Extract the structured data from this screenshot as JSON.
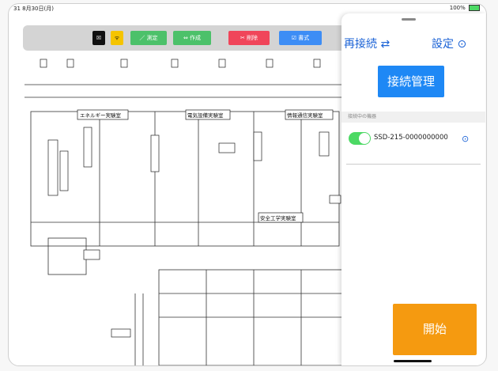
{
  "status": {
    "time": "31  8月30日(月)",
    "battery": "100%"
  },
  "toolbar": {
    "close_label": "☒",
    "wifi_icon": "wifi-icon",
    "measure_label": "／ 測定",
    "create_label": "⇔ 作成",
    "delete_label": "✂ 削除",
    "format_label": "☑ 書式"
  },
  "plan": {
    "rooms": [
      "エネルギー実験室",
      "電気設備実験室",
      "情報通信実験室",
      "安全工学実験室"
    ]
  },
  "panel": {
    "reconnect_label": "再接続",
    "settings_label": "設定",
    "manage_label": "接続管理",
    "section_label": "接続中の機器",
    "device_name": "SSD-215-0000000000",
    "start_label": "開始"
  },
  "colors": {
    "accent": "#1e88f5",
    "start": "#f59a10",
    "toggle": "#4cd964"
  }
}
